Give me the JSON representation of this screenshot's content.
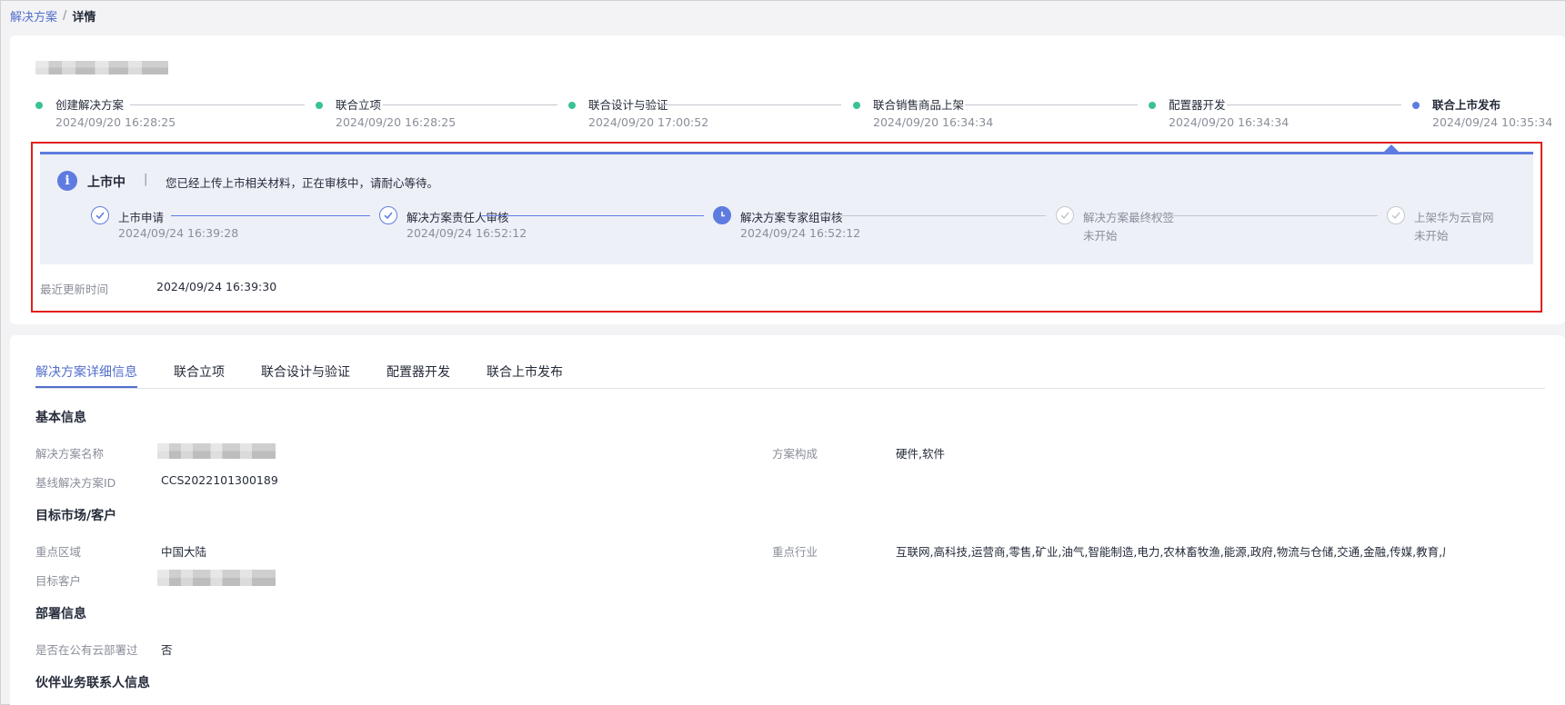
{
  "breadcrumb": {
    "parent": "解决方案",
    "separator": "/",
    "current": "详情"
  },
  "main_steps": [
    {
      "label": "创建解决方案",
      "time": "2024/09/20 16:28:25",
      "status": "done"
    },
    {
      "label": "联合立项",
      "time": "2024/09/20 16:28:25",
      "status": "done"
    },
    {
      "label": "联合设计与验证",
      "time": "2024/09/20 17:00:52",
      "status": "done"
    },
    {
      "label": "联合销售商品上架",
      "time": "2024/09/20 16:34:34",
      "status": "done"
    },
    {
      "label": "配置器开发",
      "time": "2024/09/20 16:34:34",
      "status": "done"
    },
    {
      "label": "联合上市发布",
      "time": "2024/09/24 10:35:34",
      "status": "current"
    }
  ],
  "status_panel": {
    "icon": "info-icon",
    "title": "上市中",
    "separator": "|",
    "message": "您已经上传上市相关材料，正在审核中，请耐心等待。",
    "steps": [
      {
        "label": "上市申请",
        "time": "2024/09/24 16:39:28",
        "status": "done",
        "icon": "check-circle-icon"
      },
      {
        "label": "解决方案责任人审核",
        "time": "2024/09/24 16:52:12",
        "status": "done",
        "icon": "check-circle-icon"
      },
      {
        "label": "解决方案专家组审核",
        "time": "2024/09/24 16:52:12",
        "status": "current",
        "icon": "clock-icon"
      },
      {
        "label": "解决方案最终权签",
        "time": "未开始",
        "status": "pending",
        "icon": "check-circle-icon"
      },
      {
        "label": "上架华为云官网",
        "time": "未开始",
        "status": "pending",
        "icon": "check-circle-icon"
      }
    ],
    "update_label": "最近更新时间",
    "update_value": "2024/09/24 16:39:30"
  },
  "tabs": [
    "解决方案详细信息",
    "联合立项",
    "联合设计与验证",
    "配置器开发",
    "联合上市发布"
  ],
  "active_tab": 0,
  "sections": {
    "basic": {
      "title": "基本信息",
      "name_label": "解决方案名称",
      "composition_label": "方案构成",
      "composition_value": "硬件,软件",
      "baseline_label": "基线解决方案ID",
      "baseline_value": "CCS2022101300189"
    },
    "market": {
      "title": "目标市场/客户",
      "region_label": "重点区域",
      "region_value": "中国大陆",
      "industry_label": "重点行业",
      "industry_value": "互联网,高科技,运营商,零售,矿业,油气,智能制造,电力,农林畜牧渔,能源,政府,物流与仓储,交通,金融,传媒,教育,房地产,其他",
      "customer_label": "目标客户"
    },
    "deploy": {
      "title": "部署信息",
      "public_cloud_label": "是否在公有云部署过",
      "public_cloud_value": "否"
    },
    "contact": {
      "title": "伙伴业务联系人信息"
    }
  },
  "colors": {
    "primary": "#5e7ce0",
    "link": "#526ecc",
    "done": "#3ac295",
    "highlight_border": "#e0201a",
    "panel_bg": "#eef0f8"
  }
}
